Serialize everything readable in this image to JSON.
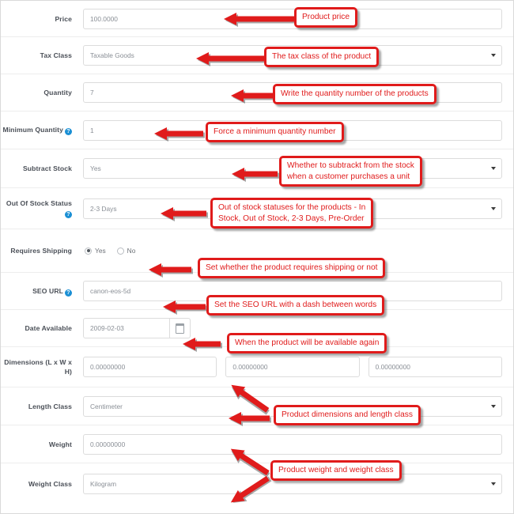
{
  "theme": {
    "accent_red": "#e01b1b",
    "help_icon_blue": "#1a8fd4",
    "label_color": "#4a4f57",
    "input_text_color": "#8a8f96",
    "border_color": "#dcdcdc"
  },
  "form": {
    "rows": [
      {
        "id": "price",
        "label": "Price",
        "help": false,
        "control": "text",
        "value": "100.0000"
      },
      {
        "id": "tax-class",
        "label": "Tax Class",
        "help": false,
        "control": "select",
        "value": "Taxable Goods"
      },
      {
        "id": "quantity",
        "label": "Quantity",
        "help": false,
        "control": "text",
        "value": "7"
      },
      {
        "id": "minimum-quantity",
        "label": "Minimum Quantity",
        "help": true,
        "control": "text",
        "value": "1"
      },
      {
        "id": "subtract-stock",
        "label": "Subtract Stock",
        "help": false,
        "control": "select",
        "value": "Yes"
      },
      {
        "id": "out-of-stock-status",
        "label": "Out Of Stock Status",
        "help": true,
        "control": "select",
        "value": "2-3 Days"
      },
      {
        "id": "requires-shipping",
        "label": "Requires Shipping",
        "help": false,
        "control": "radio",
        "options": [
          {
            "label": "Yes",
            "selected": true
          },
          {
            "label": "No",
            "selected": false
          }
        ]
      },
      {
        "id": "seo-url",
        "label": "SEO URL",
        "help": true,
        "control": "text",
        "value": "canon-eos-5d"
      },
      {
        "id": "date-available",
        "label": "Date Available",
        "help": false,
        "control": "date",
        "value": "2009-02-03"
      },
      {
        "id": "dimensions",
        "label": "Dimensions (L x W x H)",
        "help": false,
        "control": "triple",
        "values": [
          "0.00000000",
          "0.00000000",
          "0.00000000"
        ]
      },
      {
        "id": "length-class",
        "label": "Length Class",
        "help": false,
        "control": "select",
        "value": "Centimeter"
      },
      {
        "id": "weight",
        "label": "Weight",
        "help": false,
        "control": "text",
        "value": "0.00000000"
      },
      {
        "id": "weight-class",
        "label": "Weight Class",
        "help": false,
        "control": "select",
        "value": "Kilogram"
      }
    ]
  },
  "annotations": {
    "callouts": [
      {
        "id": "price-note",
        "text": "Product price"
      },
      {
        "id": "tax-class-note",
        "text": "The tax class of the product"
      },
      {
        "id": "quantity-note",
        "text": "Write the quantity number of the products"
      },
      {
        "id": "minimum-quantity-note",
        "text": "Force a minimum quantity number"
      },
      {
        "id": "subtract-stock-note",
        "text": "Whether to subtrackt from the stock\nwhen a customer purchases a unit"
      },
      {
        "id": "out-of-stock-note",
        "text": "Out of stock statuses for the products - In\nStock, Out of Stock, 2-3 Days, Pre-Order"
      },
      {
        "id": "requires-shipping-note",
        "text": "Set whether the product requires shipping or not"
      },
      {
        "id": "seo-url-note",
        "text": "Set the SEO URL with a dash between words"
      },
      {
        "id": "date-available-note",
        "text": "When the product will be available again"
      },
      {
        "id": "dimensions-note",
        "text": "Product dimensions and length class"
      },
      {
        "id": "weight-note",
        "text": "Product weight and weight class"
      }
    ]
  },
  "icons": {
    "help": "?",
    "calendar": "calendar-icon",
    "dropdown": "chevron-down-icon"
  }
}
